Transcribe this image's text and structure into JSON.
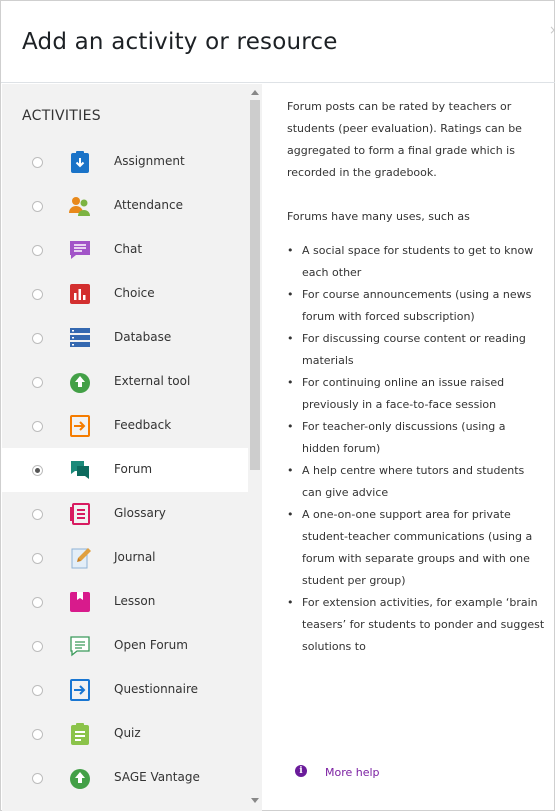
{
  "dialog": {
    "title": "Add an activity or resource",
    "close_label": "×"
  },
  "options": {
    "section_title": "ACTIVITIES",
    "items": [
      {
        "label": "Assignment",
        "icon": "assignment-icon",
        "checked": false
      },
      {
        "label": "Attendance",
        "icon": "attendance-icon",
        "checked": false
      },
      {
        "label": "Chat",
        "icon": "chat-icon",
        "checked": false
      },
      {
        "label": "Choice",
        "icon": "choice-icon",
        "checked": false
      },
      {
        "label": "Database",
        "icon": "database-icon",
        "checked": false
      },
      {
        "label": "External tool",
        "icon": "external-tool-icon",
        "checked": false
      },
      {
        "label": "Feedback",
        "icon": "feedback-icon",
        "checked": false
      },
      {
        "label": "Forum",
        "icon": "forum-icon",
        "checked": true
      },
      {
        "label": "Glossary",
        "icon": "glossary-icon",
        "checked": false
      },
      {
        "label": "Journal",
        "icon": "journal-icon",
        "checked": false
      },
      {
        "label": "Lesson",
        "icon": "lesson-icon",
        "checked": false
      },
      {
        "label": "Open Forum",
        "icon": "open-forum-icon",
        "checked": false
      },
      {
        "label": "Questionnaire",
        "icon": "questionnaire-icon",
        "checked": false
      },
      {
        "label": "Quiz",
        "icon": "quiz-icon",
        "checked": false
      },
      {
        "label": "SAGE Vantage",
        "icon": "sage-vantage-icon",
        "checked": false
      }
    ]
  },
  "help": {
    "intro": "Forum posts can be rated by teachers or students (peer evaluation). Ratings can be aggregated to form a final grade which is recorded in the gradebook.",
    "uses_heading": "Forums have many uses, such as",
    "uses": [
      "A social space for students to get to know each other",
      "For course announcements (using a news forum with forced subscription)",
      "For discussing course content or reading materials",
      "For continuing online an issue raised previously in a face-to-face session",
      "For teacher-only discussions (using a hidden forum)",
      "A help centre where tutors and students can give advice",
      "A one-on-one support area for private student-teacher communications (using a forum with separate groups and with one student per group)",
      "For extension activities, for example ‘brain teasers’ for students to ponder and suggest solutions to"
    ],
    "more_help": "More help"
  },
  "colors": {
    "selected_row": "#ffffff",
    "panel_bg": "#f2f2f2",
    "link": "#7b1fa2"
  }
}
